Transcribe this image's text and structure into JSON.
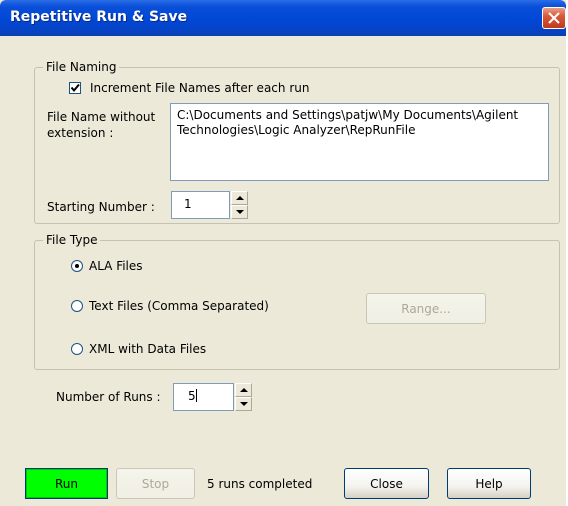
{
  "window": {
    "title": "Repetitive Run & Save"
  },
  "file_naming": {
    "legend": "File Naming",
    "increment_checkbox_label": "Increment File Names after each run",
    "increment_checked": true,
    "filename_label_line1": "File Name without",
    "filename_label_line2": "extension :",
    "filename_value": "C:\\Documents and Settings\\patjw\\My Documents\\Agilent Technologies\\Logic Analyzer\\RepRunFile",
    "starting_number_label": "Starting Number :",
    "starting_number_value": "1"
  },
  "file_type": {
    "legend": "File Type",
    "options": [
      {
        "label": "ALA Files",
        "selected": true
      },
      {
        "label": "Text Files (Comma Separated)",
        "selected": false
      },
      {
        "label": "XML with Data Files",
        "selected": false
      }
    ],
    "range_button_label": "Range..."
  },
  "runs": {
    "number_of_runs_label": "Number of Runs :",
    "number_of_runs_value": "5"
  },
  "footer": {
    "run_label": "Run",
    "stop_label": "Stop",
    "status_text": "5 runs completed",
    "close_label": "Close",
    "help_label": "Help"
  },
  "colors": {
    "titlebar": "#0047d6",
    "run_button": "#00ff00",
    "dialog_bg": "#ece9d8"
  }
}
